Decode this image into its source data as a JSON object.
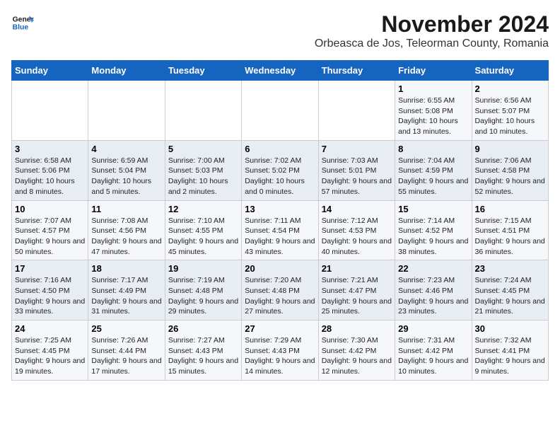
{
  "header": {
    "logo_line1": "General",
    "logo_line2": "Blue",
    "title": "November 2024",
    "subtitle": "Orbeasca de Jos, Teleorman County, Romania"
  },
  "calendar": {
    "days_of_week": [
      "Sunday",
      "Monday",
      "Tuesday",
      "Wednesday",
      "Thursday",
      "Friday",
      "Saturday"
    ],
    "weeks": [
      [
        {
          "day": "",
          "info": ""
        },
        {
          "day": "",
          "info": ""
        },
        {
          "day": "",
          "info": ""
        },
        {
          "day": "",
          "info": ""
        },
        {
          "day": "",
          "info": ""
        },
        {
          "day": "1",
          "info": "Sunrise: 6:55 AM\nSunset: 5:08 PM\nDaylight: 10 hours and 13 minutes."
        },
        {
          "day": "2",
          "info": "Sunrise: 6:56 AM\nSunset: 5:07 PM\nDaylight: 10 hours and 10 minutes."
        }
      ],
      [
        {
          "day": "3",
          "info": "Sunrise: 6:58 AM\nSunset: 5:06 PM\nDaylight: 10 hours and 8 minutes."
        },
        {
          "day": "4",
          "info": "Sunrise: 6:59 AM\nSunset: 5:04 PM\nDaylight: 10 hours and 5 minutes."
        },
        {
          "day": "5",
          "info": "Sunrise: 7:00 AM\nSunset: 5:03 PM\nDaylight: 10 hours and 2 minutes."
        },
        {
          "day": "6",
          "info": "Sunrise: 7:02 AM\nSunset: 5:02 PM\nDaylight: 10 hours and 0 minutes."
        },
        {
          "day": "7",
          "info": "Sunrise: 7:03 AM\nSunset: 5:01 PM\nDaylight: 9 hours and 57 minutes."
        },
        {
          "day": "8",
          "info": "Sunrise: 7:04 AM\nSunset: 4:59 PM\nDaylight: 9 hours and 55 minutes."
        },
        {
          "day": "9",
          "info": "Sunrise: 7:06 AM\nSunset: 4:58 PM\nDaylight: 9 hours and 52 minutes."
        }
      ],
      [
        {
          "day": "10",
          "info": "Sunrise: 7:07 AM\nSunset: 4:57 PM\nDaylight: 9 hours and 50 minutes."
        },
        {
          "day": "11",
          "info": "Sunrise: 7:08 AM\nSunset: 4:56 PM\nDaylight: 9 hours and 47 minutes."
        },
        {
          "day": "12",
          "info": "Sunrise: 7:10 AM\nSunset: 4:55 PM\nDaylight: 9 hours and 45 minutes."
        },
        {
          "day": "13",
          "info": "Sunrise: 7:11 AM\nSunset: 4:54 PM\nDaylight: 9 hours and 43 minutes."
        },
        {
          "day": "14",
          "info": "Sunrise: 7:12 AM\nSunset: 4:53 PM\nDaylight: 9 hours and 40 minutes."
        },
        {
          "day": "15",
          "info": "Sunrise: 7:14 AM\nSunset: 4:52 PM\nDaylight: 9 hours and 38 minutes."
        },
        {
          "day": "16",
          "info": "Sunrise: 7:15 AM\nSunset: 4:51 PM\nDaylight: 9 hours and 36 minutes."
        }
      ],
      [
        {
          "day": "17",
          "info": "Sunrise: 7:16 AM\nSunset: 4:50 PM\nDaylight: 9 hours and 33 minutes."
        },
        {
          "day": "18",
          "info": "Sunrise: 7:17 AM\nSunset: 4:49 PM\nDaylight: 9 hours and 31 minutes."
        },
        {
          "day": "19",
          "info": "Sunrise: 7:19 AM\nSunset: 4:48 PM\nDaylight: 9 hours and 29 minutes."
        },
        {
          "day": "20",
          "info": "Sunrise: 7:20 AM\nSunset: 4:48 PM\nDaylight: 9 hours and 27 minutes."
        },
        {
          "day": "21",
          "info": "Sunrise: 7:21 AM\nSunset: 4:47 PM\nDaylight: 9 hours and 25 minutes."
        },
        {
          "day": "22",
          "info": "Sunrise: 7:23 AM\nSunset: 4:46 PM\nDaylight: 9 hours and 23 minutes."
        },
        {
          "day": "23",
          "info": "Sunrise: 7:24 AM\nSunset: 4:45 PM\nDaylight: 9 hours and 21 minutes."
        }
      ],
      [
        {
          "day": "24",
          "info": "Sunrise: 7:25 AM\nSunset: 4:45 PM\nDaylight: 9 hours and 19 minutes."
        },
        {
          "day": "25",
          "info": "Sunrise: 7:26 AM\nSunset: 4:44 PM\nDaylight: 9 hours and 17 minutes."
        },
        {
          "day": "26",
          "info": "Sunrise: 7:27 AM\nSunset: 4:43 PM\nDaylight: 9 hours and 15 minutes."
        },
        {
          "day": "27",
          "info": "Sunrise: 7:29 AM\nSunset: 4:43 PM\nDaylight: 9 hours and 14 minutes."
        },
        {
          "day": "28",
          "info": "Sunrise: 7:30 AM\nSunset: 4:42 PM\nDaylight: 9 hours and 12 minutes."
        },
        {
          "day": "29",
          "info": "Sunrise: 7:31 AM\nSunset: 4:42 PM\nDaylight: 9 hours and 10 minutes."
        },
        {
          "day": "30",
          "info": "Sunrise: 7:32 AM\nSunset: 4:41 PM\nDaylight: 9 hours and 9 minutes."
        }
      ]
    ]
  }
}
